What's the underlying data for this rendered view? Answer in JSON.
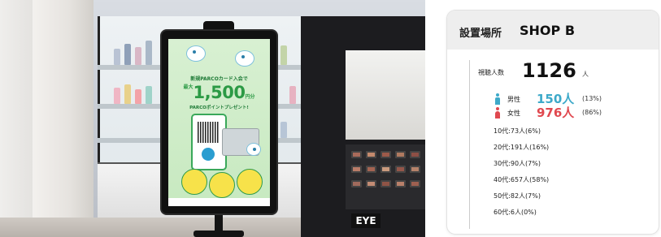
{
  "photo": {
    "sign_text": "EYE",
    "screen": {
      "headline": "新規PARCOカード入会で",
      "amount_prefix": "最大",
      "amount": "1,500",
      "amount_suffix": "円分",
      "subline": "PARCOポイントプレゼント!"
    }
  },
  "panel": {
    "location_label": "設置場所",
    "location_value": "SHOP B",
    "viewers_label": "視聴人数",
    "viewers_count": "1126",
    "viewers_unit": "人",
    "male": {
      "label": "男性",
      "count": "150人",
      "percent": "(13%)",
      "color": "#3da9c9"
    },
    "female": {
      "label": "女性",
      "count": "976人",
      "percent": "(86%)",
      "color": "#e0484f"
    },
    "age_groups": [
      "10代:73人(6%)",
      "20代:191人(16%)",
      "30代:90人(7%)",
      "40代:657人(58%)",
      "50代:82人(7%)",
      "60代:6人(0%)"
    ]
  }
}
